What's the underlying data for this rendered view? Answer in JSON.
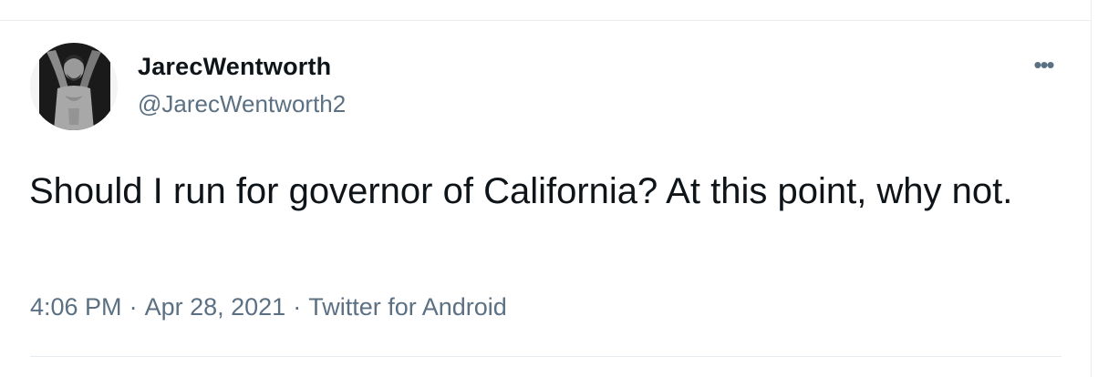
{
  "tweet": {
    "author": {
      "display_name": "JarecWentworth",
      "handle": "@JarecWentworth2",
      "avatar": "profile-photo"
    },
    "more_icon": "more-options-icon",
    "more_glyph": "•••",
    "text": "Should I run for governor of California? At this point, why not.",
    "meta": {
      "time": "4:06 PM",
      "separator": "·",
      "date": "Apr 28, 2021",
      "source": "Twitter for Android"
    }
  },
  "colors": {
    "text_primary": "#0f1419",
    "text_secondary": "#5b7083",
    "divider": "#e6ecf0"
  }
}
